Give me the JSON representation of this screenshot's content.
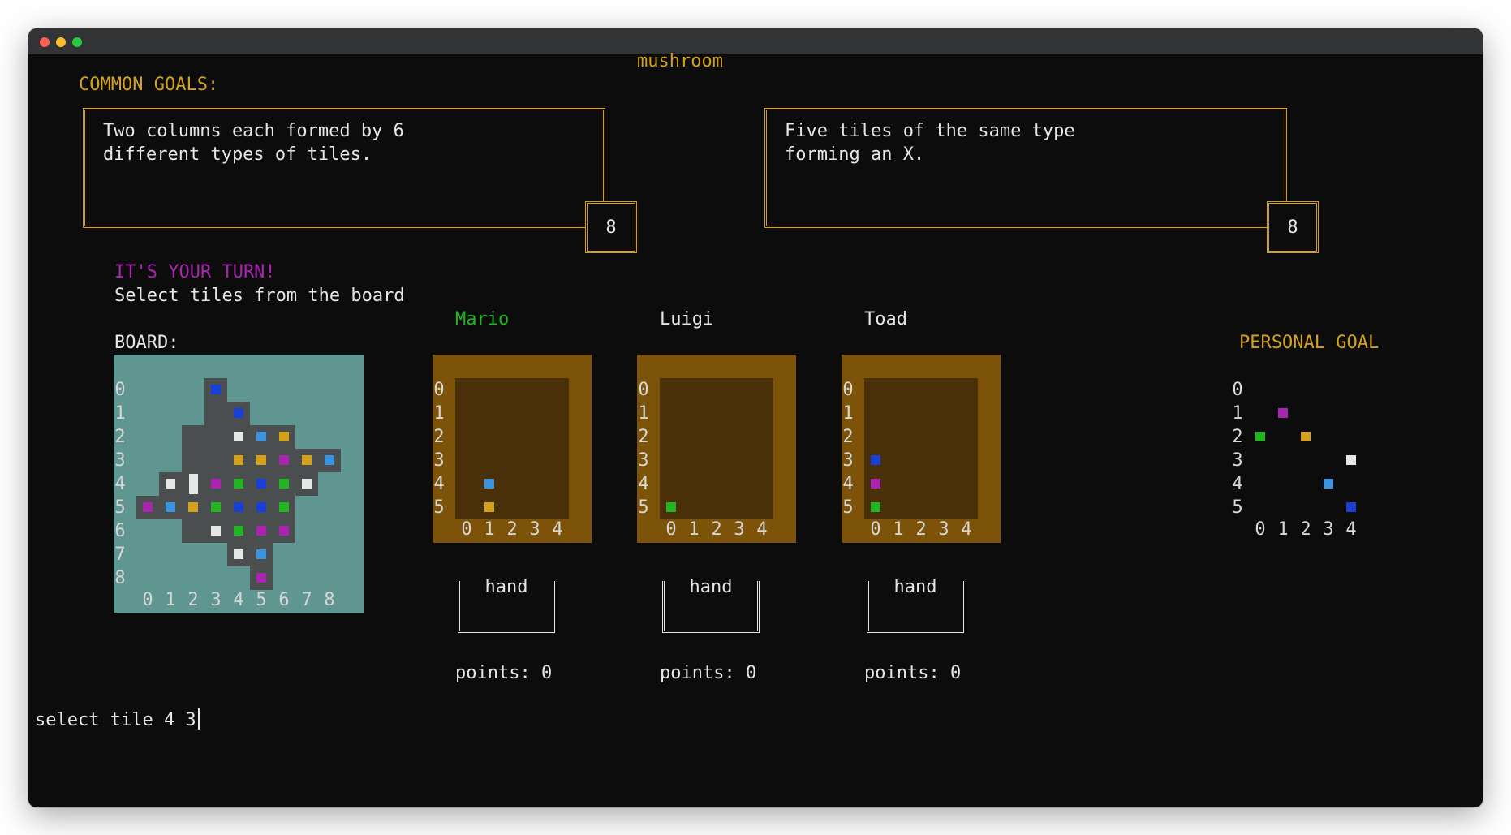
{
  "window": {
    "title": "mushroom"
  },
  "common_goals": {
    "label": "COMMON GOALS:",
    "goals": [
      {
        "line1": "Two columns each formed by 6",
        "line2": "different types of tiles.",
        "score": "8"
      },
      {
        "line1": "Five tiles of the same type",
        "line2": "forming an X.",
        "score": "8"
      }
    ]
  },
  "status": {
    "turn": "IT'S YOUR TURN!",
    "instruction": "Select tiles from the board"
  },
  "board": {
    "label": "BOARD:",
    "row_labels": [
      "0",
      "1",
      "2",
      "3",
      "4",
      "5",
      "6",
      "7",
      "8"
    ],
    "col_labels": [
      "0",
      "1",
      "2",
      "3",
      "4",
      "5",
      "6",
      "7",
      "8"
    ]
  },
  "players": [
    {
      "name": "Mario",
      "hand_label": "hand",
      "points": "points: 0",
      "current": true
    },
    {
      "name": "Luigi",
      "hand_label": "hand",
      "points": "points: 0",
      "current": false
    },
    {
      "name": "Toad",
      "hand_label": "hand",
      "points": "points: 0",
      "current": false
    }
  ],
  "shelf": {
    "row_labels": [
      "0",
      "1",
      "2",
      "3",
      "4",
      "5"
    ],
    "col_labels": [
      "0",
      "1",
      "2",
      "3",
      "4"
    ]
  },
  "personal_goal": {
    "label": "PERSONAL GOAL",
    "row_labels": [
      "0",
      "1",
      "2",
      "3",
      "4",
      "5"
    ],
    "col_labels": [
      "0",
      "1",
      "2",
      "3",
      "4"
    ]
  },
  "command": {
    "input": "select tile 4 3"
  },
  "colors": {
    "gold": "#d4a21a",
    "purple": "#a925b0",
    "green": "#22b522",
    "blue": "#1a3fd6",
    "light_blue": "#3b93dd",
    "white": "#e6e6e6",
    "board_bg": "#5f9691",
    "shelf": "#7d5209"
  }
}
